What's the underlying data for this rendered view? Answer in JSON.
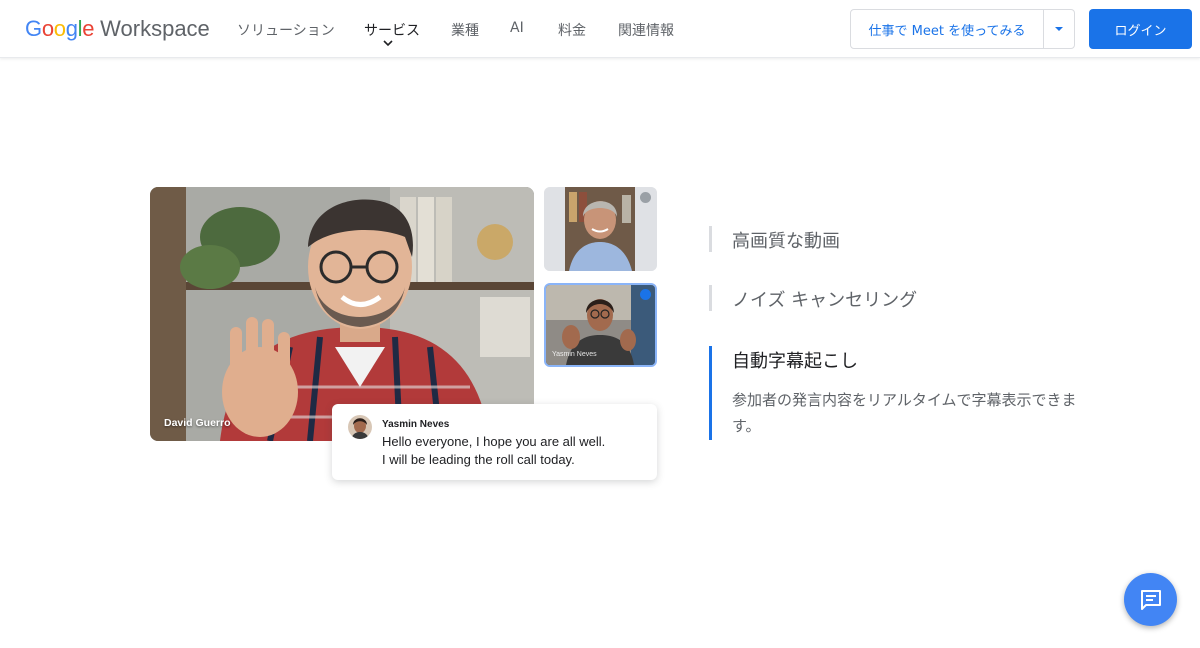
{
  "header": {
    "logo": {
      "google": "Google",
      "product": "Workspace",
      "letter_colors": [
        "#4285F4",
        "#EA4335",
        "#FBBC05",
        "#4285F4",
        "#34A853",
        "#EA4335"
      ]
    },
    "nav": [
      {
        "label": "ソリューション"
      },
      {
        "label": "サービス",
        "active": true
      },
      {
        "label": "業種"
      },
      {
        "label": "AI"
      },
      {
        "label": "料金"
      },
      {
        "label": "関連情報"
      }
    ],
    "cta_label": "仕事で Meet を使ってみる",
    "login_label": "ログイン",
    "accent_color": "#1A73E8"
  },
  "meeting": {
    "main_speaker": "David Guerro",
    "thumbnails": [
      {
        "name": "",
        "status": "muted"
      },
      {
        "name": "Yasmin Neves",
        "status": "speaking"
      }
    ],
    "caption": {
      "speaker": "Yasmin Neves",
      "line1": "Hello everyone, I hope you are all well.",
      "line2": "I will be leading the roll call today."
    }
  },
  "features": [
    {
      "title": "高画質な動画",
      "active": false
    },
    {
      "title": "ノイズ キャンセリング",
      "active": false
    },
    {
      "title": "自動字幕起こし",
      "active": true,
      "description": "参加者の発言内容をリアルタイムで字幕表示できます。"
    }
  ],
  "chat_fab_icon": "chat-icon"
}
